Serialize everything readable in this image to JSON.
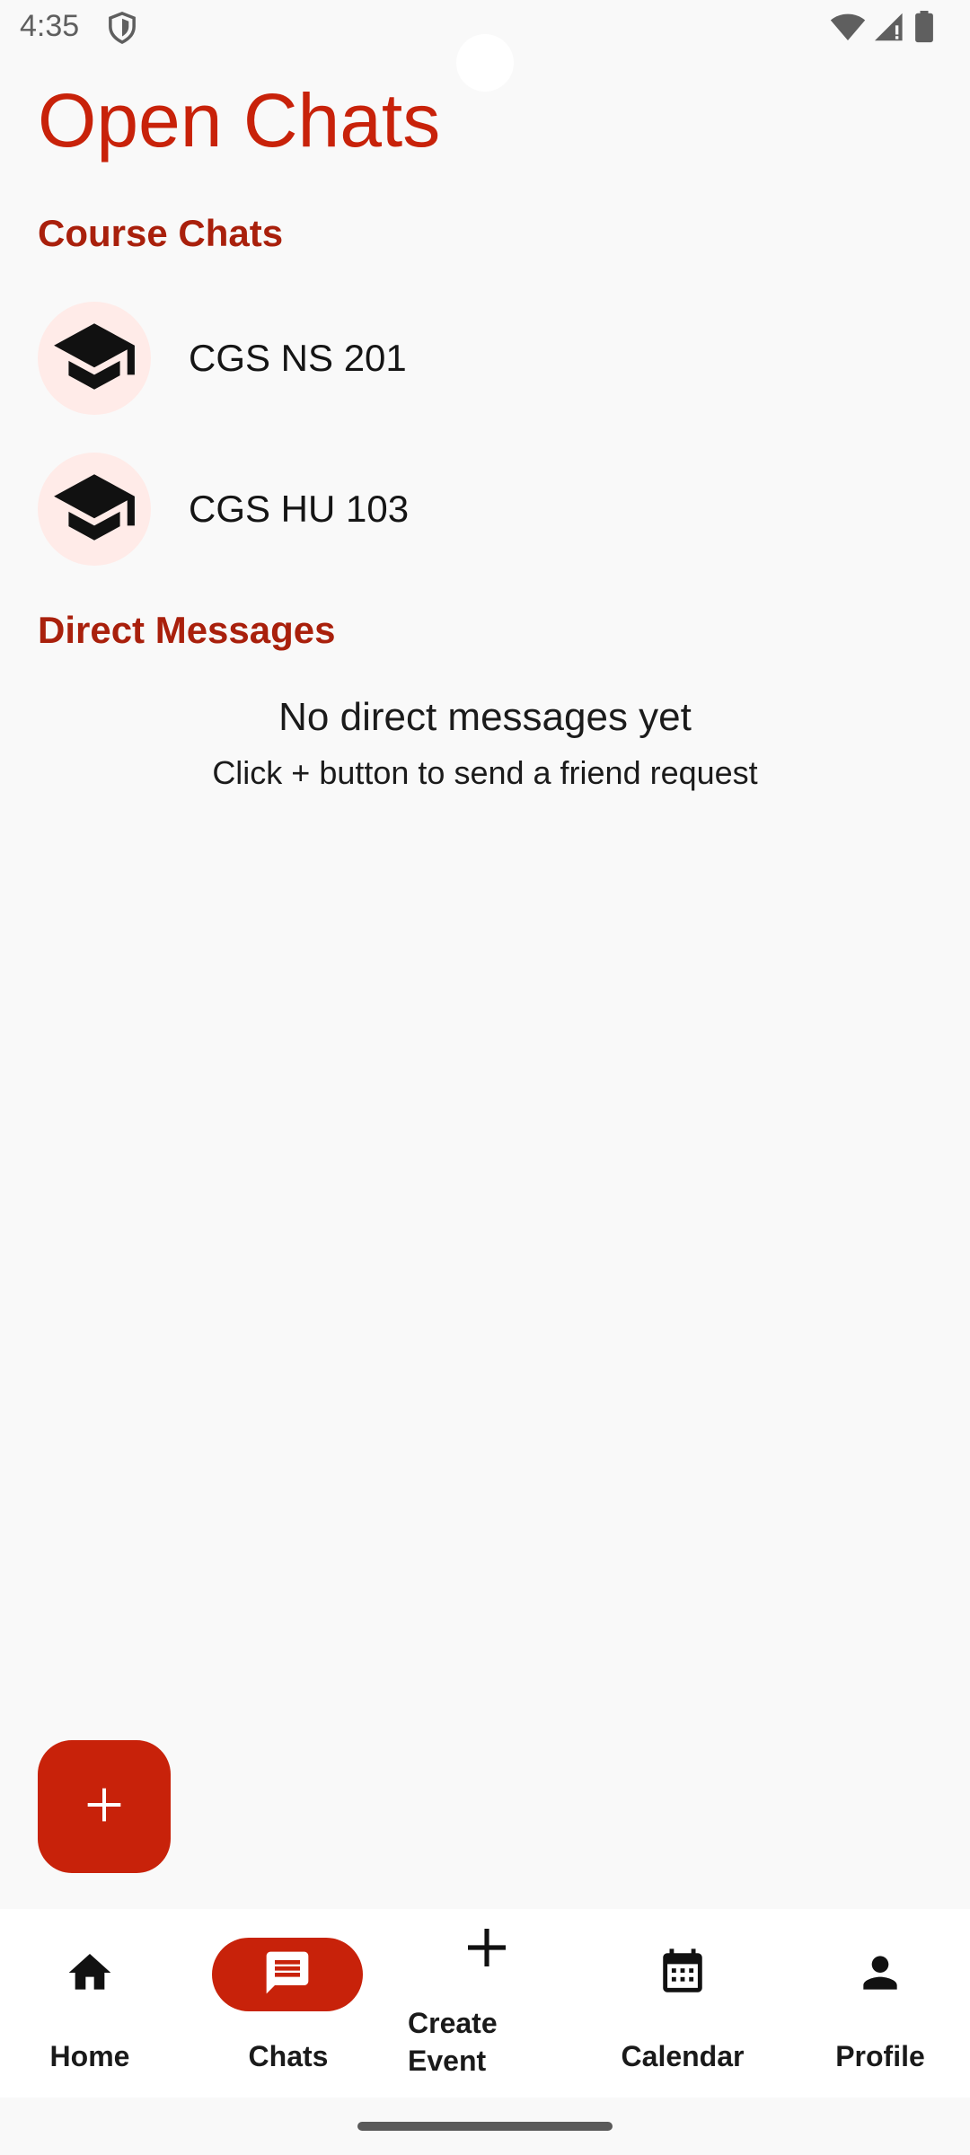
{
  "status_bar": {
    "time": "4:35",
    "icons": [
      "shield-icon",
      "wifi-icon",
      "signal-icon",
      "battery-icon"
    ]
  },
  "page": {
    "title": "Open Chats"
  },
  "course_chats": {
    "label": "Course Chats",
    "items": [
      {
        "name": "CGS NS 201",
        "icon": "graduation-cap-icon"
      },
      {
        "name": "CGS HU 103",
        "icon": "graduation-cap-icon"
      }
    ]
  },
  "direct_messages": {
    "label": "Direct Messages",
    "empty_title": "No direct messages yet",
    "empty_subtitle": "Click + button to send a friend request"
  },
  "fab": {
    "icon": "plus-icon"
  },
  "bottom_nav": {
    "items": [
      {
        "label": "Home",
        "icon": "home-icon",
        "active": false
      },
      {
        "label": "Chats",
        "icon": "chat-icon",
        "active": true
      },
      {
        "label": "Create Event",
        "icon": "plus-icon",
        "active": false
      },
      {
        "label": "Calendar",
        "icon": "calendar-icon",
        "active": false
      },
      {
        "label": "Profile",
        "icon": "person-icon",
        "active": false
      }
    ]
  },
  "colors": {
    "accent": "#c8220a",
    "section_label": "#a9200c",
    "avatar_bg": "#ffebe8",
    "background": "#f9f9f9"
  }
}
